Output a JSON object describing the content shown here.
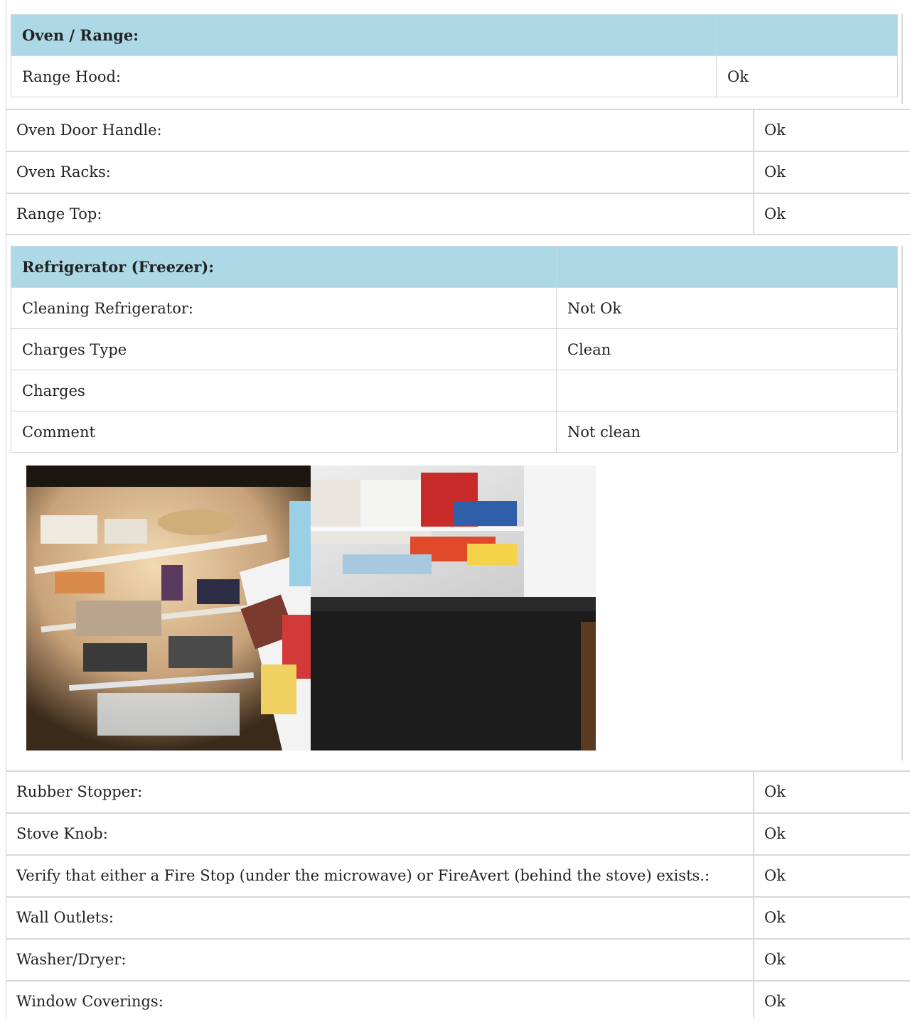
{
  "oven_range": {
    "title": "Oven / Range:",
    "rows": [
      {
        "label": "Range Hood:",
        "value": "Ok"
      }
    ]
  },
  "items_a": [
    {
      "label": "Oven Door Handle:",
      "value": "Ok"
    },
    {
      "label": "Oven Racks:",
      "value": "Ok"
    },
    {
      "label": "Range Top:",
      "value": "Ok"
    }
  ],
  "refrigerator": {
    "title": "Refrigerator (Freezer):",
    "rows": [
      {
        "label": "Cleaning Refrigerator:",
        "value": "Not Ok"
      },
      {
        "label": "Charges Type",
        "value": "Clean"
      },
      {
        "label": "Charges",
        "value": ""
      },
      {
        "label": "Comment",
        "value": "Not clean"
      }
    ],
    "photo_alt": "refrigerator interior photos"
  },
  "items_b": [
    {
      "label": "Rubber Stopper:",
      "value": "Ok"
    },
    {
      "label": "Stove Knob:",
      "value": "Ok"
    },
    {
      "label": "Verify that either a Fire Stop (under the microwave) or FireAvert (behind the stove) exists.:",
      "value": "Ok"
    },
    {
      "label": "Wall Outlets:",
      "value": "Ok"
    },
    {
      "label": "Washer/Dryer:",
      "value": "Ok"
    },
    {
      "label": "Window Coverings:",
      "value": "Ok"
    }
  ],
  "colors": {
    "section_header_bg": "#add8e6",
    "border": "#d3d3d3",
    "text": "#222222"
  }
}
